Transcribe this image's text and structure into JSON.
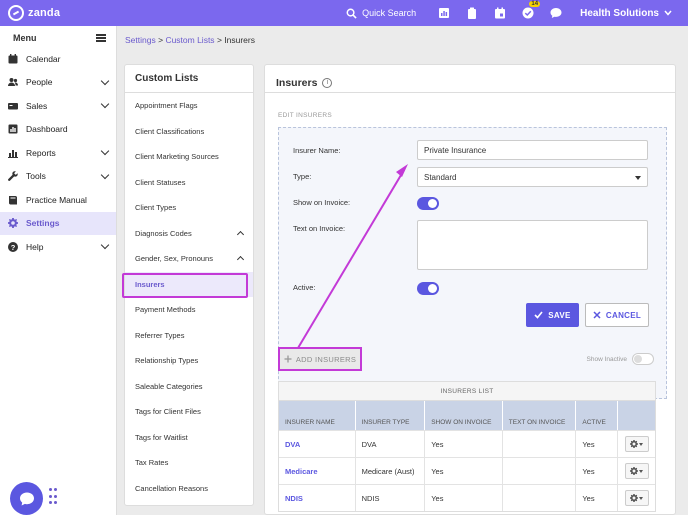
{
  "topbar": {
    "logo_text": "zanda",
    "quick_search": "Quick Search",
    "notification_count": "14",
    "account_name": "Health Solutions",
    "bg_color": "#7b68ee"
  },
  "sidebar": {
    "menu_label": "Menu",
    "items": [
      {
        "label": "Calendar",
        "icon": "calendar-icon"
      },
      {
        "label": "People",
        "icon": "people-icon"
      },
      {
        "label": "Sales",
        "icon": "sales-icon"
      },
      {
        "label": "Dashboard",
        "icon": "dashboard-icon"
      },
      {
        "label": "Reports",
        "icon": "reports-icon"
      },
      {
        "label": "Tools",
        "icon": "tools-icon"
      },
      {
        "label": "Practice Manual",
        "icon": "book-icon"
      },
      {
        "label": "Settings",
        "icon": "gear-icon"
      },
      {
        "label": "Help",
        "icon": "help-icon"
      }
    ]
  },
  "breadcrumb": {
    "settings": "Settings",
    "sep1": ">",
    "custom_lists": "Custom Lists",
    "sep2": ">",
    "current": "Insurers"
  },
  "custom_lists": {
    "title": "Custom Lists",
    "items": [
      "Appointment Flags",
      "Client Classifications",
      "Client Marketing Sources",
      "Client Statuses",
      "Client Types",
      "Diagnosis Codes",
      "Gender, Sex, Pronouns",
      "Insurers",
      "Payment Methods",
      "Referrer Types",
      "Relationship Types",
      "Saleable Categories",
      "Tags for Client Files",
      "Tags for Waitlist",
      "Tax Rates",
      "Cancellation Reasons"
    ]
  },
  "insurers": {
    "title": "Insurers",
    "info_glyph": "i",
    "edit_heading": "EDIT INSURERS",
    "form": {
      "name_label": "Insurer Name:",
      "name_value": "Private Insurance",
      "type_label": "Type:",
      "type_value": "Standard",
      "show_on_invoice_label": "Show on Invoice:",
      "text_on_invoice_label": "Text on Invoice:",
      "text_on_invoice_value": "",
      "active_label": "Active:",
      "save_label": "SAVE",
      "cancel_label": "CANCEL"
    },
    "add_label": "ADD INSURERS",
    "show_inactive_label": "Show Inactive",
    "table": {
      "caption": "INSURERS LIST",
      "headers": [
        "INSURER NAME",
        "INSURER TYPE",
        "SHOW ON INVOICE",
        "TEXT ON INVOICE",
        "ACTIVE",
        ""
      ],
      "rows": [
        {
          "name": "DVA",
          "type": "DVA",
          "show": "Yes",
          "text": "",
          "active": "Yes"
        },
        {
          "name": "Medicare",
          "type": "Medicare (Aust)",
          "show": "Yes",
          "text": "",
          "active": "Yes"
        },
        {
          "name": "NDIS",
          "type": "NDIS",
          "show": "Yes",
          "text": "",
          "active": "Yes"
        }
      ]
    }
  },
  "colors": {
    "accent": "#5b57e0",
    "highlight": "#c33ad7"
  }
}
